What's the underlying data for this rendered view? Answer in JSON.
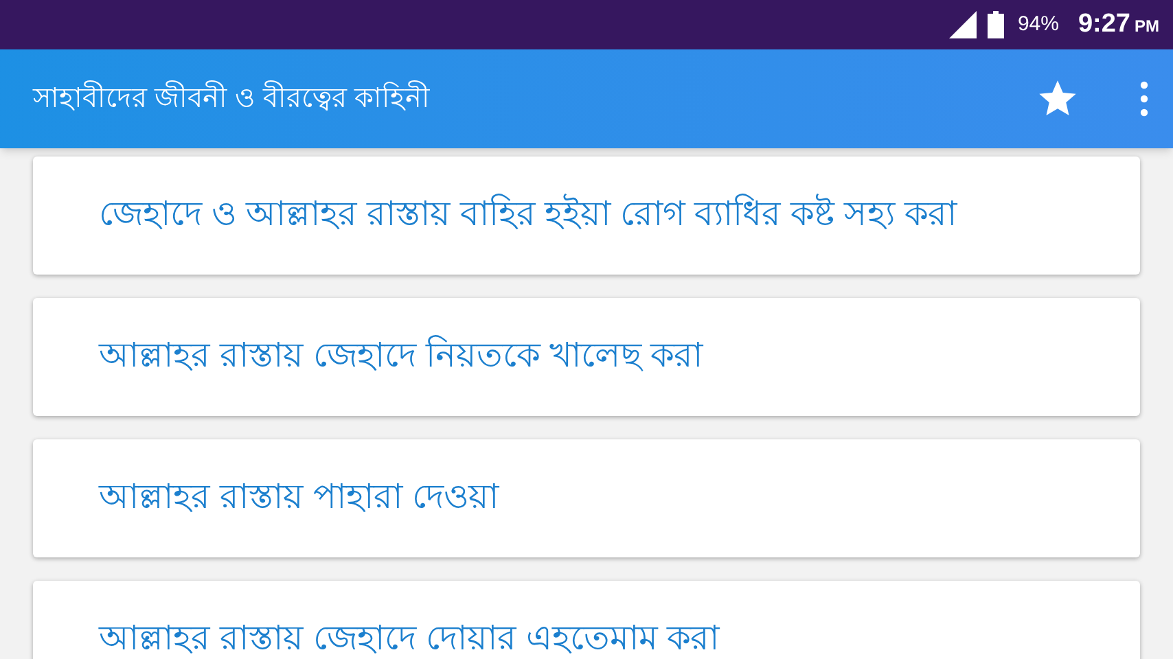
{
  "status_bar": {
    "battery": "94%",
    "time": "9:27",
    "period": "PM"
  },
  "app_bar": {
    "title": "সাহাবীদের জীবনী ও বীরত্বের কাহিনী"
  },
  "items": [
    {
      "title": "জেহাদে ও আল্লাহর রাস্তায় বাহির হইয়া রোগ ব্যাধির কষ্ট সহ্য করা"
    },
    {
      "title": "আল্লাহর রাস্তায় জেহাদে নিয়তকে খালেছ করা"
    },
    {
      "title": "আল্লাহর রাস্তায় পাহারা দেওয়া"
    },
    {
      "title": "আল্লাহর রাস্তায় জেহাদে দোয়ার এহতেমাম করা"
    }
  ]
}
